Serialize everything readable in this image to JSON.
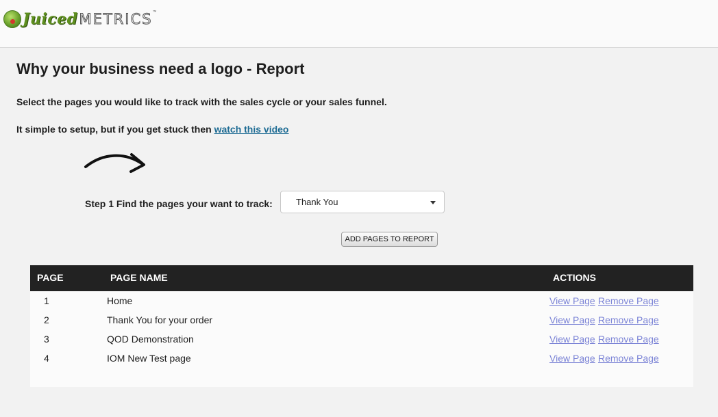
{
  "brand": {
    "part1": "Juiced",
    "part2": "METRICS",
    "tm": "™"
  },
  "page": {
    "title": "Why your business need a logo - Report",
    "instruction": "Select the pages you would like to track with the sales cycle or your sales funnel.",
    "setup_text": "It simple to setup, but if you get stuck then ",
    "video_link": "watch this video"
  },
  "step": {
    "label": "Step 1 Find the pages your want to track:",
    "selected": "Thank You",
    "add_button": "ADD PAGES TO REPORT"
  },
  "table": {
    "headers": {
      "page": "PAGE",
      "name": "PAGE NAME",
      "actions": "ACTIONS"
    },
    "rows": [
      {
        "num": "1",
        "name": "Home",
        "view": "View Page",
        "remove": "Remove Page"
      },
      {
        "num": "2",
        "name": "Thank You for your order",
        "view": "View Page",
        "remove": "Remove Page"
      },
      {
        "num": "3",
        "name": "QOD Demonstration",
        "view": "View Page",
        "remove": "Remove Page"
      },
      {
        "num": "4",
        "name": "IOM New Test page",
        "view": "View Page",
        "remove": "Remove Page"
      }
    ]
  },
  "colors": {
    "link": "#1e6c94",
    "action_link": "#7b83d6",
    "table_header": "#222222"
  },
  "icons": {
    "logo": "juicedmetrics-logo-badge",
    "arrow": "curved-arrow-icon",
    "caret": "chevron-down-icon"
  }
}
